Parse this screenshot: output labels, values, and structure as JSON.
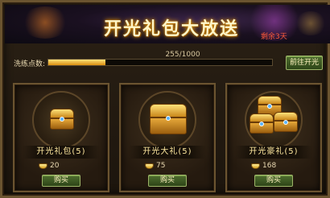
{
  "header": {
    "title": "开光礼包大放送",
    "remaining": "剩余3天"
  },
  "progress": {
    "label": "洗练点数:",
    "text": "255/1000",
    "current": 255,
    "max": 1000,
    "fraction": 0.255,
    "action_label": "前往开光"
  },
  "packages": [
    {
      "name": "开光礼包(5)",
      "price": "20",
      "buy_label": "购买",
      "icon": "single-chest-icon"
    },
    {
      "name": "开光大礼(5)",
      "price": "75",
      "buy_label": "购买",
      "icon": "large-chest-icon"
    },
    {
      "name": "开光豪礼(5)",
      "price": "168",
      "buy_label": "购买",
      "icon": "chest-stack-icon"
    }
  ],
  "colors": {
    "gold": "#ffe27a",
    "remaining_red": "#ff5a3a",
    "button_green": "#3e5a24"
  }
}
